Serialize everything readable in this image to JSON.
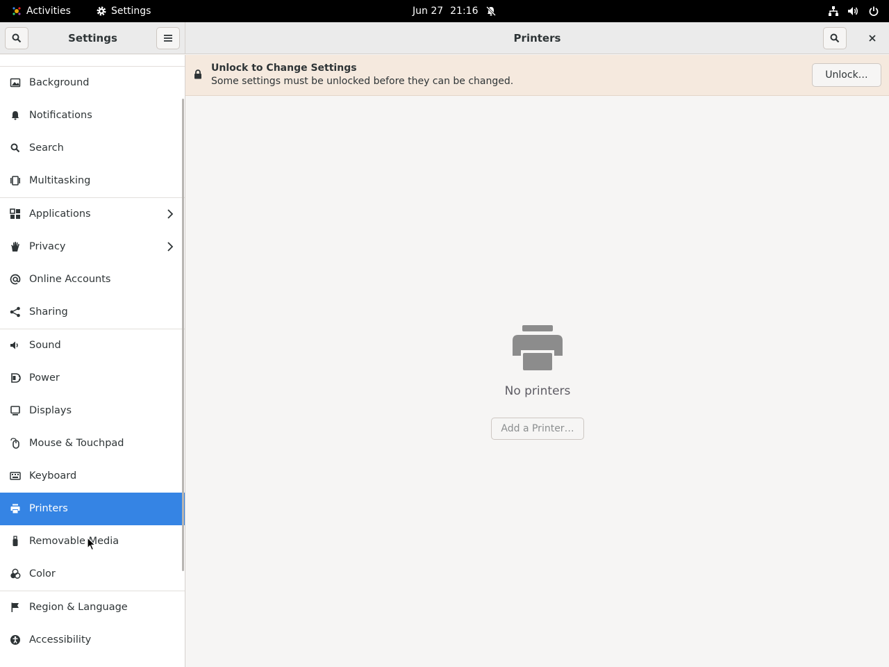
{
  "topbar": {
    "activities_label": "Activities",
    "app_label": "Settings",
    "date": "Jun 27",
    "time": "21:16",
    "icons": [
      "network-icon",
      "volume-icon",
      "power-icon",
      "notifications-disabled-icon"
    ]
  },
  "sidebar": {
    "title": "Settings",
    "items": [
      {
        "label": "Background",
        "icon": "background-icon"
      },
      {
        "label": "Notifications",
        "icon": "bell-icon"
      },
      {
        "label": "Search",
        "icon": "search-icon"
      },
      {
        "label": "Multitasking",
        "icon": "multitasking-icon"
      },
      {
        "label": "Applications",
        "icon": "apps-grid-icon",
        "has_submenu": true
      },
      {
        "label": "Privacy",
        "icon": "hand-icon",
        "has_submenu": true
      },
      {
        "label": "Online Accounts",
        "icon": "at-sign-icon"
      },
      {
        "label": "Sharing",
        "icon": "share-icon"
      },
      {
        "label": "Sound",
        "icon": "speaker-icon"
      },
      {
        "label": "Power",
        "icon": "battery-icon"
      },
      {
        "label": "Displays",
        "icon": "display-icon"
      },
      {
        "label": "Mouse & Touchpad",
        "icon": "mouse-icon"
      },
      {
        "label": "Keyboard",
        "icon": "keyboard-icon"
      },
      {
        "label": "Printers",
        "icon": "printer-icon",
        "selected": true
      },
      {
        "label": "Removable Media",
        "icon": "usb-icon"
      },
      {
        "label": "Color",
        "icon": "color-icon"
      },
      {
        "label": "Region & Language",
        "icon": "flag-icon"
      },
      {
        "label": "Accessibility",
        "icon": "accessibility-icon"
      }
    ]
  },
  "main": {
    "title": "Printers",
    "infobar": {
      "title": "Unlock to Change Settings",
      "message": "Some settings must be unlocked before they can be changed.",
      "button_label": "Unlock…"
    },
    "empty_state": {
      "message": "No printers",
      "button_label": "Add a Printer…"
    }
  },
  "colors": {
    "accent": "#3584e4",
    "infobar_bg": "#f5e9de"
  }
}
